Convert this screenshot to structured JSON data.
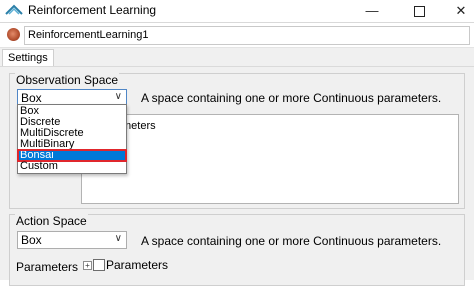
{
  "window": {
    "title": "Reinforcement Learning"
  },
  "component": {
    "name": "ReinforcementLearning1"
  },
  "tabs": [
    {
      "label": "Settings"
    }
  ],
  "observation": {
    "group_label": "Observation Space",
    "selected": "Box",
    "description": "A space containing one or more Continuous parameters.",
    "params_partial_text": "meters",
    "options": [
      "Box",
      "Discrete",
      "MultiDiscrete",
      "MultiBinary",
      "Bonsai",
      "Custom"
    ],
    "highlighted_option": "Bonsai"
  },
  "action": {
    "group_label": "Action Space",
    "selected": "Box",
    "description": "A space containing one or more Continuous parameters.",
    "params_label": "Parameters",
    "tree_root_label": "Parameters",
    "expander_glyph": "+"
  },
  "icons": {
    "minimize": "minimize-icon",
    "maximize": "maximize-icon",
    "close": "close-icon",
    "chevron": "chevron-down-icon"
  },
  "colors": {
    "highlight_bg": "#0078d7",
    "highlight_outline": "#e0262c"
  }
}
